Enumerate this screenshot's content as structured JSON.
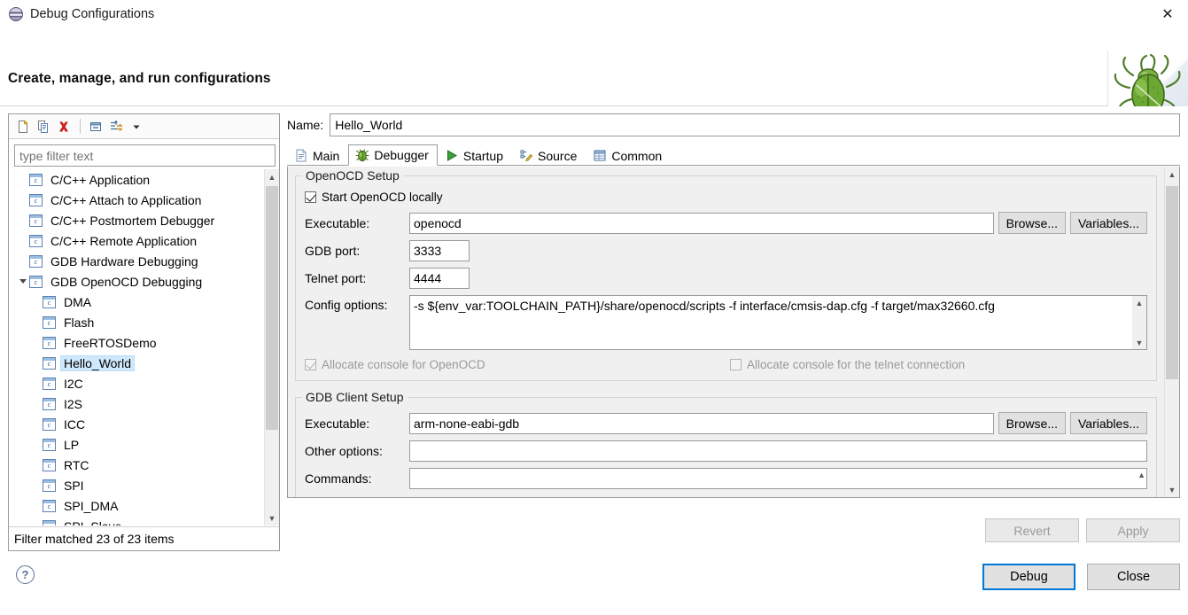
{
  "window": {
    "title": "Debug Configurations",
    "icon": "eclipse-sphere-icon",
    "close_label": "✕"
  },
  "header": {
    "title": "Create, manage, and run configurations",
    "mascot_icon": "green-bug-icon"
  },
  "left_panel": {
    "toolbar": [
      {
        "name": "new-configuration-icon",
        "tooltip": "New launch configuration"
      },
      {
        "name": "duplicate-configuration-icon",
        "tooltip": "Duplicate"
      },
      {
        "name": "delete-configuration-icon",
        "tooltip": "Delete"
      },
      {
        "name": "collapse-all-icon",
        "tooltip": "Collapse All"
      },
      {
        "name": "filter-launch-configurations-icon",
        "tooltip": "Filter"
      },
      {
        "name": "view-menu-chevron-icon",
        "tooltip": "View Menu"
      }
    ],
    "filter": {
      "placeholder": "type filter text",
      "value": ""
    },
    "tree": [
      {
        "label": "C/C++ Application",
        "indent": 0,
        "expanded": null,
        "selected": false
      },
      {
        "label": "C/C++ Attach to Application",
        "indent": 0,
        "expanded": null,
        "selected": false
      },
      {
        "label": "C/C++ Postmortem Debugger",
        "indent": 0,
        "expanded": null,
        "selected": false
      },
      {
        "label": "C/C++ Remote Application",
        "indent": 0,
        "expanded": null,
        "selected": false
      },
      {
        "label": "GDB Hardware Debugging",
        "indent": 0,
        "expanded": null,
        "selected": false
      },
      {
        "label": "GDB OpenOCD Debugging",
        "indent": 0,
        "expanded": true,
        "selected": false
      },
      {
        "label": "DMA",
        "indent": 1,
        "expanded": null,
        "selected": false
      },
      {
        "label": "Flash",
        "indent": 1,
        "expanded": null,
        "selected": false
      },
      {
        "label": "FreeRTOSDemo",
        "indent": 1,
        "expanded": null,
        "selected": false
      },
      {
        "label": "Hello_World",
        "indent": 1,
        "expanded": null,
        "selected": true
      },
      {
        "label": "I2C",
        "indent": 1,
        "expanded": null,
        "selected": false
      },
      {
        "label": "I2S",
        "indent": 1,
        "expanded": null,
        "selected": false
      },
      {
        "label": "ICC",
        "indent": 1,
        "expanded": null,
        "selected": false
      },
      {
        "label": "LP",
        "indent": 1,
        "expanded": null,
        "selected": false
      },
      {
        "label": "RTC",
        "indent": 1,
        "expanded": null,
        "selected": false
      },
      {
        "label": "SPI",
        "indent": 1,
        "expanded": null,
        "selected": false
      },
      {
        "label": "SPI_DMA",
        "indent": 1,
        "expanded": null,
        "selected": false
      },
      {
        "label": "SPI_Slave",
        "indent": 1,
        "expanded": null,
        "selected": false
      }
    ],
    "status": "Filter matched 23 of 23 items"
  },
  "config": {
    "name_label": "Name:",
    "name_value": "Hello_World",
    "tabs": [
      {
        "label": "Main",
        "icon": "document-icon",
        "active": false
      },
      {
        "label": "Debugger",
        "icon": "bug-icon",
        "active": true
      },
      {
        "label": "Startup",
        "icon": "play-arrow-icon",
        "active": false
      },
      {
        "label": "Source",
        "icon": "source-edit-icon",
        "active": false
      },
      {
        "label": "Common",
        "icon": "table-icon",
        "active": false
      }
    ],
    "openocd_setup": {
      "group_title": "OpenOCD Setup",
      "start_locally": {
        "label": "Start OpenOCD locally",
        "checked": true,
        "enabled": true
      },
      "executable": {
        "label": "Executable:",
        "value": "openocd",
        "browse_label": "Browse...",
        "variables_label": "Variables..."
      },
      "gdb_port": {
        "label": "GDB port:",
        "value": "3333"
      },
      "telnet_port": {
        "label": "Telnet port:",
        "value": "4444"
      },
      "config_options": {
        "label": "Config options:",
        "value": "-s ${env_var:TOOLCHAIN_PATH}/share/openocd/scripts -f interface/cmsis-dap.cfg -f target/max32660.cfg"
      },
      "allocate_console_openocd": {
        "label": "Allocate console for OpenOCD",
        "checked": true,
        "enabled": false
      },
      "allocate_console_telnet": {
        "label": "Allocate console for the telnet connection",
        "checked": false,
        "enabled": false
      }
    },
    "gdb_client_setup": {
      "group_title": "GDB Client Setup",
      "executable": {
        "label": "Executable:",
        "value": "arm-none-eabi-gdb",
        "browse_label": "Browse...",
        "variables_label": "Variables..."
      },
      "other_options": {
        "label": "Other options:",
        "value": ""
      },
      "commands": {
        "label": "Commands:",
        "value": ""
      }
    },
    "revert_label": "Revert",
    "apply_label": "Apply",
    "revert_enabled": false,
    "apply_enabled": false
  },
  "footer": {
    "help_label": "?",
    "debug_label": "Debug",
    "close_label": "Close"
  },
  "colors": {
    "selection_blue": "#cfe8fb",
    "focus_blue": "#0078d7",
    "delete_red": "#cc2222",
    "bug_green": "#5ba52e",
    "disabled_gray": "#9a9a9a"
  }
}
